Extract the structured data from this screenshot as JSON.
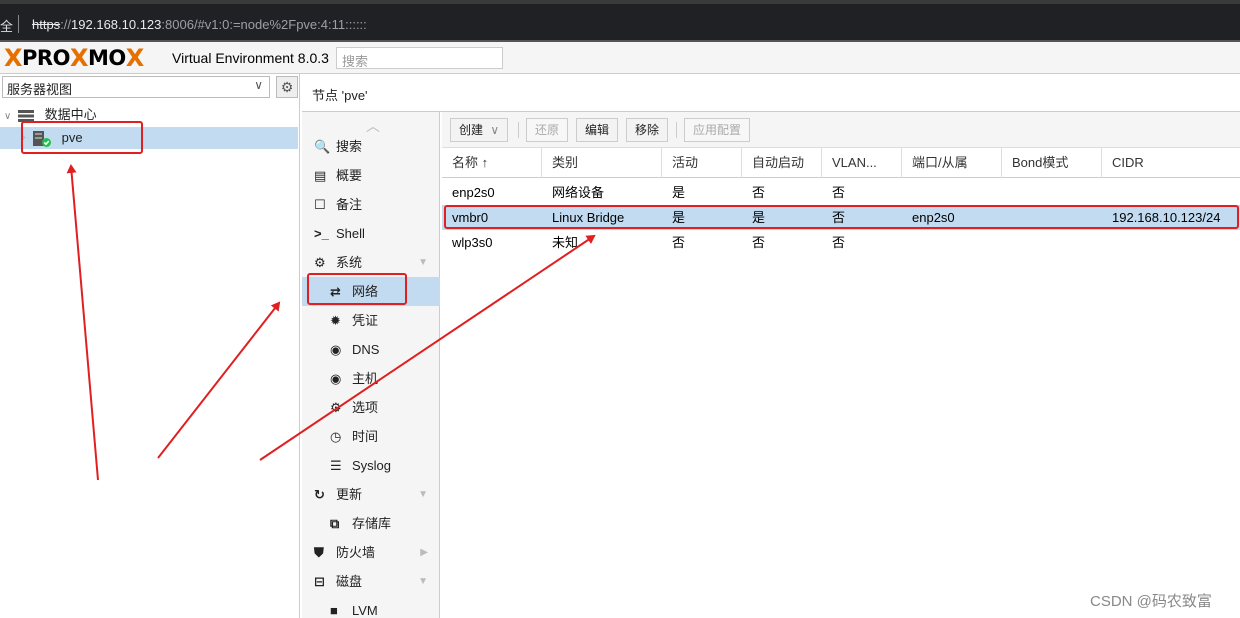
{
  "browser": {
    "lock_text": "全",
    "url_scheme": "https",
    "url_sep": "://",
    "url_host": "192.168.10.123",
    "url_rest": ":8006/#v1:0:=node%2Fpve:4:11::::::"
  },
  "header": {
    "logo_text_1": "PRO",
    "logo_x": "X",
    "logo_text_2": "MO",
    "logo_x2": "X",
    "version": "Virtual Environment 8.0.3",
    "search_placeholder": "搜索"
  },
  "tree": {
    "view_select": "服务器视图",
    "datacenter": "数据中心",
    "node": "pve"
  },
  "content": {
    "title": "节点 'pve'"
  },
  "nav": [
    {
      "label": "搜索",
      "icon": "🔍",
      "sub": false
    },
    {
      "label": "概要",
      "icon": "▤",
      "sub": false
    },
    {
      "label": "备注",
      "icon": "☐",
      "sub": false
    },
    {
      "label": "Shell",
      "icon": ">_",
      "sub": false
    },
    {
      "label": "系统",
      "icon": "⚙",
      "sub": false,
      "expand": "▼"
    },
    {
      "label": "网络",
      "icon": "⇄",
      "sub": true,
      "selected": true
    },
    {
      "label": "凭证",
      "icon": "✹",
      "sub": true
    },
    {
      "label": "DNS",
      "icon": "◉",
      "sub": true
    },
    {
      "label": "主机",
      "icon": "◉",
      "sub": true
    },
    {
      "label": "选项",
      "icon": "⚙",
      "sub": true
    },
    {
      "label": "时间",
      "icon": "◷",
      "sub": true
    },
    {
      "label": "Syslog",
      "icon": "☰",
      "sub": true
    },
    {
      "label": "更新",
      "icon": "↻",
      "sub": false,
      "expand": "▼"
    },
    {
      "label": "存储库",
      "icon": "⧉",
      "sub": true
    },
    {
      "label": "防火墙",
      "icon": "⛊",
      "sub": false,
      "expand": "▶"
    },
    {
      "label": "磁盘",
      "icon": "⊟",
      "sub": false,
      "expand": "▼"
    },
    {
      "label": "LVM",
      "icon": "■",
      "sub": true
    }
  ],
  "toolbar": {
    "create": "创建",
    "create_arrow": "∨",
    "revert": "还原",
    "edit": "编辑",
    "remove": "移除",
    "apply": "应用配置"
  },
  "grid": {
    "columns": [
      "名称 ↑",
      "类别",
      "活动",
      "自动启动",
      "VLAN...",
      "端口/从属",
      "Bond模式",
      "CIDR"
    ],
    "rows": [
      {
        "name": "enp2s0",
        "type": "网络设备",
        "active": "是",
        "autostart": "否",
        "vlan": "否",
        "ports": "",
        "bond": "",
        "cidr": ""
      },
      {
        "name": "vmbr0",
        "type": "Linux Bridge",
        "active": "是",
        "autostart": "是",
        "vlan": "否",
        "ports": "enp2s0",
        "bond": "",
        "cidr": "192.168.10.123/24"
      },
      {
        "name": "wlp3s0",
        "type": "未知",
        "active": "否",
        "autostart": "否",
        "vlan": "否",
        "ports": "",
        "bond": "",
        "cidr": ""
      }
    ]
  },
  "watermark": "CSDN @码农致富",
  "colors": {
    "selection": "#c2dbf1",
    "annotation_red": "#e02020",
    "logo_orange": "#e57000"
  }
}
